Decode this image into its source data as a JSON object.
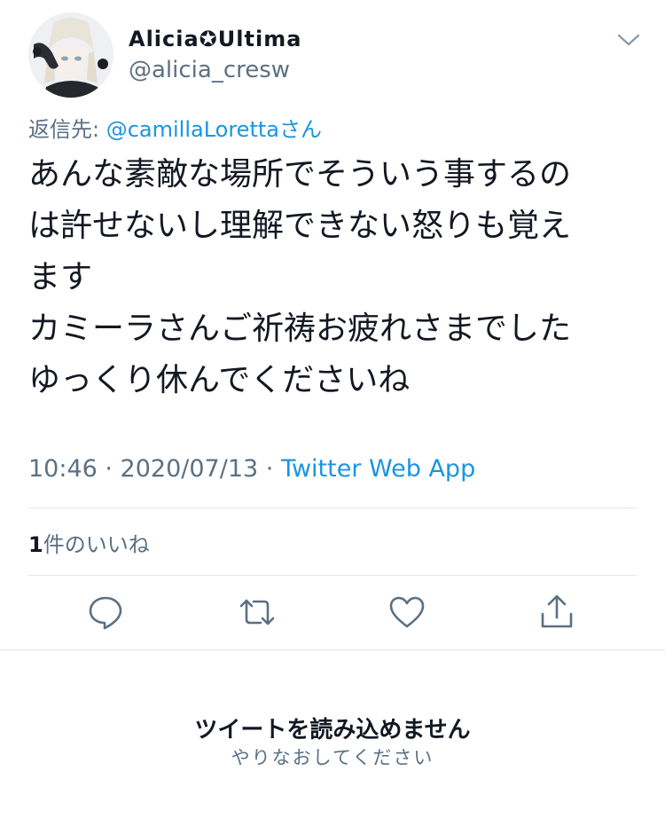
{
  "author": {
    "display_name": "Alicia✪Ultima",
    "handle": "@alicia_cresw",
    "avatar_icon": "anime-character-avatar"
  },
  "reply": {
    "prefix": "返信先: ",
    "mention": "@camillaLorettaさん"
  },
  "tweet": {
    "lines": [
      "あんな素敵な場所でそういう事するの",
      "は許せないし理解できない怒りも覚え",
      "ます",
      "カミーラさんご祈祷お疲れさまでした",
      "ゆっくり休んでくださいね"
    ]
  },
  "meta": {
    "time_date": "10:46 · 2020/07/13 · ",
    "source": "Twitter Web App"
  },
  "likes": {
    "count": "1",
    "label": "件のいいね"
  },
  "actions": [
    {
      "name": "reply",
      "icon": "speech-bubble-icon"
    },
    {
      "name": "retweet",
      "icon": "retweet-icon"
    },
    {
      "name": "like",
      "icon": "heart-icon"
    },
    {
      "name": "share",
      "icon": "share-icon"
    }
  ],
  "error": {
    "title": "ツイートを読み込めません",
    "subtitle": "やりなおしてください"
  },
  "colors": {
    "text": "#141823",
    "muted": "#5b7083",
    "link": "#1b95e0",
    "divider": "#e1e8ed"
  }
}
